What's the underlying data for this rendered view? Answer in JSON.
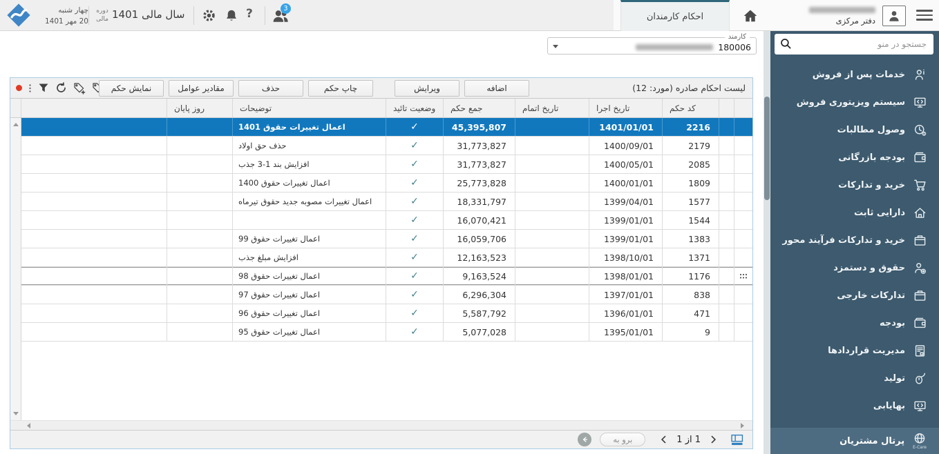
{
  "topbar": {
    "weekday": "چهار شنبه",
    "date": "20 مهر 1401",
    "fiscal_period_label": "دوره مالی",
    "fiscal_year": "سال مالی 1401",
    "notifications_badge": "3",
    "active_tab": "احکام کارمندان",
    "office": "دفتر مرکزی"
  },
  "sidebar": {
    "search_placeholder": "جستجو در منو",
    "items": [
      {
        "name": "after-sales",
        "label": "خدمات پس از فروش",
        "icon": "person-info"
      },
      {
        "name": "visitor-sales",
        "label": "سیستم ویزیتوری فروش",
        "icon": "monitor"
      },
      {
        "name": "receivables",
        "label": "وصول مطالبات",
        "icon": "clock"
      },
      {
        "name": "commercial-budget",
        "label": "بودجه بازرگانی",
        "icon": "wallet"
      },
      {
        "name": "procurement",
        "label": "خرید و تدارکات",
        "icon": "cart"
      },
      {
        "name": "fixed-assets",
        "label": "دارایی ثابت",
        "icon": "home"
      },
      {
        "name": "process-procurement",
        "label": "خرید و تدارکات فرآیند محور",
        "icon": "box"
      },
      {
        "name": "payroll",
        "label": "حقوق و دستمزد",
        "icon": "person-coin"
      },
      {
        "name": "foreign-procurement",
        "label": "تدارکات خارجی",
        "icon": "box"
      },
      {
        "name": "budget",
        "label": "بودجه",
        "icon": "wallet"
      },
      {
        "name": "contracts",
        "label": "مدیریت قراردادها",
        "icon": "contract"
      },
      {
        "name": "production",
        "label": "تولید",
        "icon": "mouse"
      },
      {
        "name": "costing",
        "label": "بهایابی",
        "icon": "monitor"
      }
    ],
    "footer": {
      "name": "customers-portal",
      "label": "پرتال مشتریان",
      "icon": "globe",
      "icon_caption": "E-Care"
    }
  },
  "employee_field": {
    "label": "کارمند",
    "code": "180006"
  },
  "toolbar": {
    "title": "لیست احکام صادره (مورد: 12)",
    "buttons": [
      {
        "name": "show-decree-button",
        "label": "نمایش حکم"
      },
      {
        "name": "factor-values-button",
        "label": "مقادیر عوامل"
      },
      {
        "name": "delete-button",
        "label": "حذف"
      },
      {
        "name": "print-decree-button",
        "label": "چاپ حکم"
      },
      {
        "name": "edit-button",
        "label": "ویرایش"
      },
      {
        "name": "add-button",
        "label": "اضافه"
      }
    ]
  },
  "table": {
    "headers": {
      "end_day": "روز پایان",
      "desc": "توضیحات",
      "approved": "وضعیت تائید",
      "total": "جمع حکم",
      "end_date": "تاریخ اتمام",
      "exec_date": "تاریخ اجرا",
      "code": "کد حکم"
    },
    "check_glyph": "✓",
    "rows": [
      {
        "code": "2216",
        "exec_date": "1401/01/01",
        "end_date": "",
        "total": "45,395,807",
        "approved": true,
        "desc": "اعمال تغییرات حقوق 1401",
        "end_day": "",
        "selected": true
      },
      {
        "code": "2179",
        "exec_date": "1400/09/01",
        "end_date": "",
        "total": "31,773,827",
        "approved": true,
        "desc": "حذف حق اولاد",
        "end_day": ""
      },
      {
        "code": "2085",
        "exec_date": "1400/05/01",
        "end_date": "",
        "total": "31,773,827",
        "approved": true,
        "desc": "افزایش بند 1-3 جذب",
        "end_day": ""
      },
      {
        "code": "1809",
        "exec_date": "1400/01/01",
        "end_date": "",
        "total": "25,773,828",
        "approved": true,
        "desc": "اعمال تغییرات حقوق 1400",
        "end_day": ""
      },
      {
        "code": "1577",
        "exec_date": "1399/04/01",
        "end_date": "",
        "total": "18,331,797",
        "approved": true,
        "desc": "اعمال تغییرات مصوبه جدید حقوق تیرماه",
        "end_day": ""
      },
      {
        "code": "1544",
        "exec_date": "1399/01/01",
        "end_date": "",
        "total": "16,070,421",
        "approved": true,
        "desc": "",
        "end_day": ""
      },
      {
        "code": "1383",
        "exec_date": "1399/01/01",
        "end_date": "",
        "total": "16,059,706",
        "approved": true,
        "desc": "اعمال تغییرات حقوق 99",
        "end_day": ""
      },
      {
        "code": "1371",
        "exec_date": "1398/10/01",
        "end_date": "",
        "total": "12,163,523",
        "approved": true,
        "desc": "افزایش مبلغ جذب",
        "end_day": ""
      },
      {
        "code": "1176",
        "exec_date": "1398/01/01",
        "end_date": "",
        "total": "9,163,524",
        "approved": true,
        "desc": "اعمال تغییرات حقوق 98",
        "end_day": "",
        "focused": true
      },
      {
        "code": "838",
        "exec_date": "1397/01/01",
        "end_date": "",
        "total": "6,296,304",
        "approved": true,
        "desc": "اعمال تغییرات حقوق 97",
        "end_day": ""
      },
      {
        "code": "471",
        "exec_date": "1396/01/01",
        "end_date": "",
        "total": "5,587,792",
        "approved": true,
        "desc": "اعمال تغییرات حقوق 96",
        "end_day": ""
      },
      {
        "code": "9",
        "exec_date": "1395/01/01",
        "end_date": "",
        "total": "5,077,028",
        "approved": true,
        "desc": "اعمال تغییرات حقوق 95",
        "end_day": ""
      }
    ]
  },
  "pagination": {
    "goto_label": "برو به",
    "page_info": "1 از 1"
  },
  "colors": {
    "accent_blue": "#1178be",
    "selected_row_bg": "#1178be",
    "sidebar_bg": "#3d5a6e",
    "sidebar_footer_bg": "#4e6c81",
    "panel_border": "#a9cbe5",
    "check_teal": "#41808e",
    "badge_blue": "#36a3e8",
    "logo_blue": "#3f86c6",
    "pager_icon_blue": "#2e7fc0"
  }
}
